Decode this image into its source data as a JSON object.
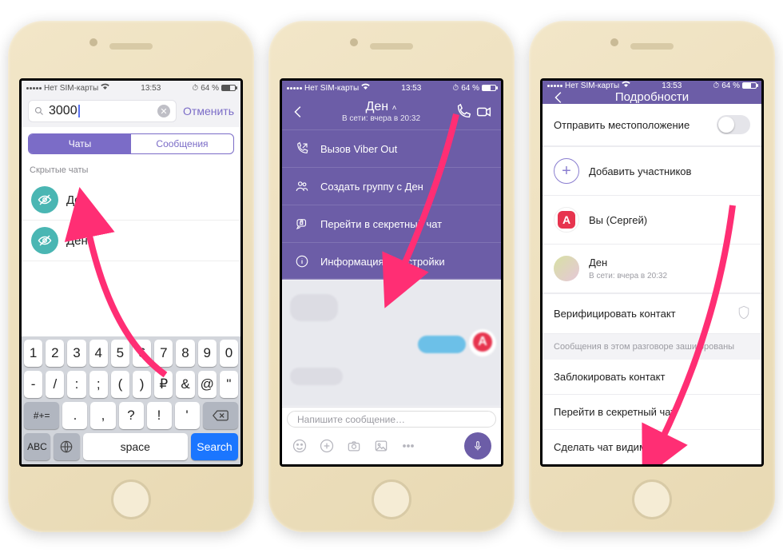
{
  "status": {
    "carrier": "Нет SIM-карты",
    "time": "13:53",
    "battery_pct": "64 %"
  },
  "screen1": {
    "search_value": "3000",
    "cancel": "Отменить",
    "tab_chats": "Чаты",
    "tab_messages": "Сообщения",
    "section_hidden": "Скрытые чаты",
    "chats": [
      {
        "name": "Ден"
      },
      {
        "name": "Ден"
      }
    ],
    "keys_row1": [
      "1",
      "2",
      "3",
      "4",
      "5",
      "6",
      "7",
      "8",
      "9",
      "0"
    ],
    "keys_row2": [
      "-",
      "/",
      ":",
      ";",
      "(",
      ")",
      "₽",
      "&",
      "@",
      "\""
    ],
    "keys_row3_mid": [
      ".",
      ",",
      "?",
      "!",
      "'"
    ],
    "key_numswitch": "#+=",
    "key_abc": "ABC",
    "key_space": "space",
    "key_search": "Search"
  },
  "screen2": {
    "contact_name": "Ден",
    "presence": "В сети: вчера в 20:32",
    "menu": {
      "call_out": "Вызов Viber Out",
      "create_group": "Создать группу с Ден",
      "secret_chat": "Перейти в секретный чат",
      "info_settings": "Информация и настройки"
    },
    "composer_placeholder": "Напишите сообщение…"
  },
  "screen3": {
    "title": "Подробности",
    "send_location": "Отправить местоположение",
    "add_participants": "Добавить участников",
    "you_label": "Вы (Сергей)",
    "contact_name": "Ден",
    "contact_presence": "В сети: вчера в 20:32",
    "verify_contact": "Верифицировать контакт",
    "encryption_note": "Сообщения в этом разговоре зашифрованы",
    "block_contact": "Заблокировать контакт",
    "go_secret": "Перейти в секретный чат",
    "make_visible": "Сделать чат видимым"
  },
  "colors": {
    "accent": "#6c5da7",
    "arrow": "#ff2e74"
  }
}
